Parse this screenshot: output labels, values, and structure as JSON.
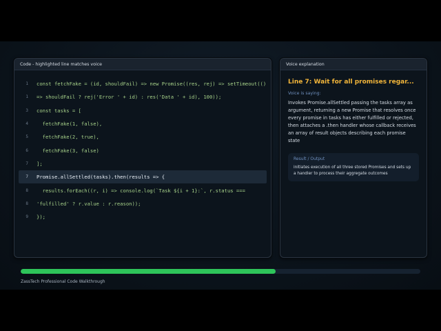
{
  "code_panel": {
    "header": "Code - highlighted line matches voice",
    "active_line": 7,
    "lines": [
      {
        "num": "1",
        "text": "const fetchFake = (id, shouldFail) => new Promise((res, rej) => setTimeout(() =>"
      },
      {
        "num": "1",
        "text": "=> shouldFail ? rej('Error ' + id) : res('Data ' + id), 100));"
      },
      {
        "num": "3",
        "text": "const tasks = ["
      },
      {
        "num": "4",
        "text": "  fetchFake(1, false),"
      },
      {
        "num": "5",
        "text": "  fetchFake(2, true),"
      },
      {
        "num": "6",
        "text": "  fetchFake(3, false)"
      },
      {
        "num": "7",
        "text": "];"
      },
      {
        "num": "7",
        "text": "Promise.allSettled(tasks).then(results => {"
      },
      {
        "num": "8",
        "text": "  results.forEach((r, i) => console.log(`Task ${i + 1}:`, r.status ==="
      },
      {
        "num": "8",
        "text": "'fulfilled' ? r.value : r.reason));"
      },
      {
        "num": "9",
        "text": "});"
      }
    ]
  },
  "voice_panel": {
    "header": "Voice explanation",
    "title": "Line 7: Wait for all promises regar...",
    "saying_label": "Voice is saying:",
    "text": "Invokes Promise.allSettled passing the tasks array as argument, returning a new Promise that resolves once every promise in tasks has either fulfilled or rejected, then attaches a .then handler whose callback receives an array of result objects describing each promise state",
    "result": {
      "label": "Result / Output",
      "text": "initiates execution of all three stored Promises and sets up a handler to process their aggregate outcomes"
    }
  },
  "progress": {
    "fraction": 0.638,
    "color": "#2ec45a"
  },
  "footer": "ZassTech Professional Code Walkthrough"
}
